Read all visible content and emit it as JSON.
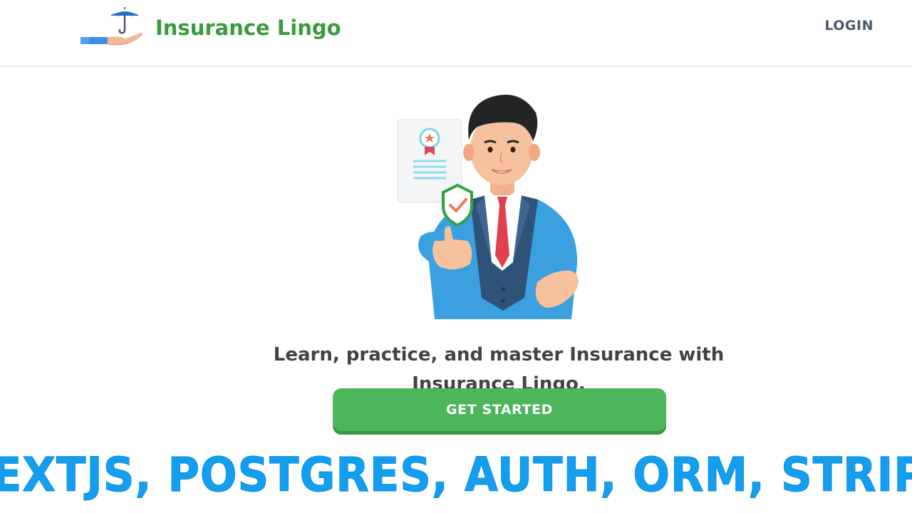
{
  "header": {
    "brand": "Insurance Lingo",
    "login_label": "LOGIN",
    "logo_icon": "umbrella-hand-icon"
  },
  "hero": {
    "illustration": "businessman-with-certificate-illustration",
    "tagline_line1": "Learn, practice, and master Insurance with",
    "tagline_line2": "Insurance Lingo.",
    "cta_label": "GET STARTED"
  },
  "banner": {
    "text": "NEXTJS, POSTGRES, AUTH, ORM, STRIPE"
  },
  "colors": {
    "brand_green": "#3a9a3e",
    "cta_green": "#4db55b",
    "banner_blue": "#139ef0",
    "text_dark": "#3f4348",
    "login_gray": "#4a5a6a"
  }
}
